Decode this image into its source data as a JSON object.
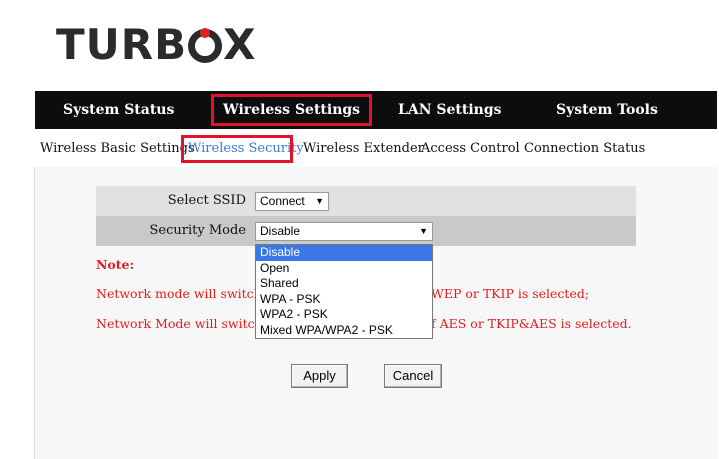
{
  "brand": {
    "prefix": "TURB",
    "suffix": "X"
  },
  "nav": {
    "items": [
      {
        "label": "System Status"
      },
      {
        "label": "Wireless Settings"
      },
      {
        "label": "LAN Settings"
      },
      {
        "label": "System Tools"
      }
    ]
  },
  "subnav": {
    "items": [
      {
        "label": "Wireless Basic Settings"
      },
      {
        "label": "Wireless Security"
      },
      {
        "label": "Wireless Extender"
      },
      {
        "label": "Access Control"
      },
      {
        "label": "Connection Status"
      }
    ]
  },
  "form": {
    "ssid": {
      "label": "Select SSID",
      "value": "Connect"
    },
    "security": {
      "label": "Security Mode",
      "value": "Disable",
      "options": [
        "Disable",
        "Open",
        "Shared",
        "WPA - PSK",
        "WPA2 - PSK",
        "Mixed WPA/WPA2 - PSK"
      ]
    }
  },
  "notes": {
    "title": "Note:",
    "line1_left": "Network mode will switch t",
    "line1_right": "WEP or TKIP is selected;",
    "line2_left": "Network Mode will switch t",
    "line2_right": "f AES or TKIP&AES is selected."
  },
  "buttons": {
    "apply": "Apply",
    "cancel": "Cancel"
  },
  "colors": {
    "highlight": "#e3122b",
    "selected": "#3b78e7",
    "note": "#e31b1b",
    "nav_bg": "#0d0d0d"
  }
}
